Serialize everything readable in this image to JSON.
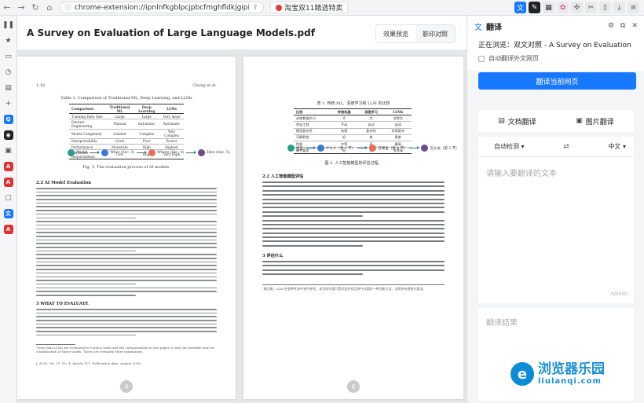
{
  "browser": {
    "url": "chrome-extension://ipnlnfkgblpcjpbcfmghfldkjgipi",
    "bookmark_label": "淘宝双11精选特卖"
  },
  "document": {
    "title": "A Survey on Evaluation of Large Language Models.pdf",
    "view_tabs": [
      "效果预览",
      "影印对照"
    ],
    "page1": {
      "header_left": "1:16",
      "header_right": "Chang et al.",
      "table_caption": "Table 1. Comparison of Traditional ML, Deep Learning, and LLMs",
      "table_headers": [
        "Comparison",
        "Traditional ML",
        "Deep Learning",
        "LLMs"
      ],
      "table_rows": [
        [
          "Training Data Size",
          "Large",
          "Large",
          "Very large"
        ],
        [
          "Feature Engineering",
          "Manual",
          "Automatic",
          "Automatic"
        ],
        [
          "Model Complexity",
          "Limited",
          "Complex",
          "Very Complex"
        ],
        [
          "Interpretability",
          "Good",
          "Poor",
          "Poorer"
        ],
        [
          "Performance",
          "Moderate",
          "High",
          "Highest"
        ],
        [
          "Hardware Requirements",
          "Low",
          "High",
          "Very High"
        ]
      ],
      "flow_labels": [
        "Model",
        "What (Sec. 3)",
        "Where (Sec. 4)",
        "How (Sec. 5)"
      ],
      "figure_caption": "Fig. 3. The evaluation process of AI models.",
      "section_22": "2.2    AI Model Evaluation",
      "section_3": "3    WHAT TO EVALUATE",
      "footnote": "¹Note that LLMs are evaluated in various tasks and the categorization in this paper is only one possible way for classification of these works. There are certainly other taxonomies.",
      "journal": "J. ACM, Vol. 37, No. 4, Article 111. Publication date: August 2018.",
      "page_number": "4"
    },
    "page2": {
      "table_caption": "表 1. 传统 ML、深度学习和 LLM 的比较",
      "table_headers": [
        "比较",
        "传统机器",
        "深度学习",
        "LLMs"
      ],
      "table_rows": [
        [
          "训练数据大小",
          "大",
          "大",
          "非常大"
        ],
        [
          "特征工程",
          "手动",
          "自动",
          "自动"
        ],
        [
          "模型复杂性",
          "有限",
          "复杂的",
          "非常复杂"
        ],
        [
          "可解释性",
          "好",
          "差",
          "更差"
        ],
        [
          "性能",
          "中等",
          "高",
          "最高"
        ],
        [
          "硬件要求",
          "低",
          "高",
          "非常高"
        ]
      ],
      "flow_labels": [
        "模型",
        "什么人（第 3 节）",
        "在哪里（第 4 节）",
        "怎么办（第 5 节）"
      ],
      "figure_caption": "图 3. 人工智能模型的评估过程。",
      "section_22": "2.2    人工智能模型评估",
      "section_3": "3    评估什么",
      "footnote": "¹请注意，LLM 在各种任务中进行评估，本文的分类只是对这些作品进行分类的一种可能方法。当然还有其他分类法。",
      "page_number": "6"
    }
  },
  "panel": {
    "title": "翻译",
    "current_site": "正在浏览：双文对照 - A Survey on Evaluation of L...",
    "auto_translate_label": "自动翻译外文网页",
    "translate_page_button": "翻译当前网页",
    "doc_tab": "文档翻译",
    "image_tab": "图片翻译",
    "source_lang": "自动检测",
    "target_lang": "中文",
    "input_placeholder": "请输入要翻译的文本",
    "char_counter": "0/5000",
    "result_placeholder": "翻译结果"
  },
  "watermark": {
    "cn": "浏览器乐园",
    "en": "liulanqi.com"
  }
}
